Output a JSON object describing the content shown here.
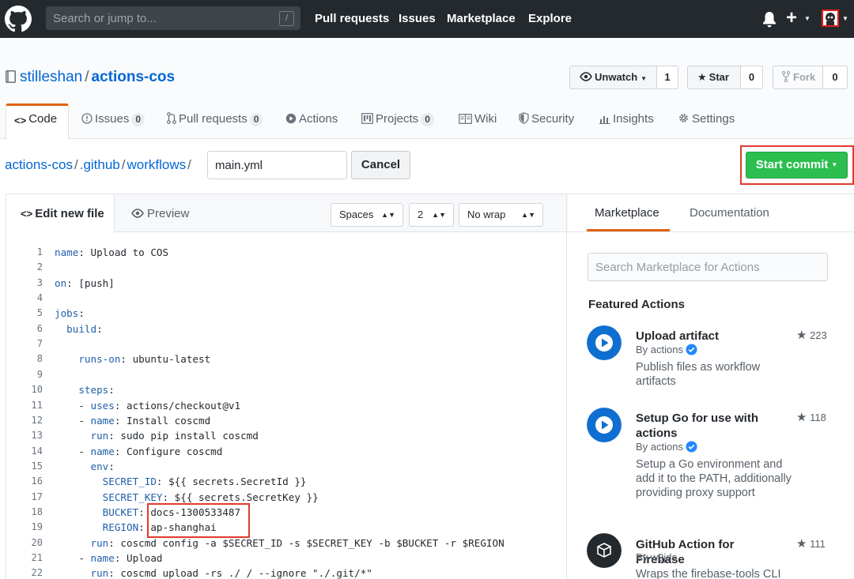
{
  "header": {
    "search_placeholder": "Search or jump to...",
    "search_key": "/",
    "nav": [
      "Pull requests",
      "Issues",
      "Marketplace",
      "Explore"
    ],
    "plus": "+"
  },
  "repo": {
    "owner": "stilleshan",
    "separator": "/",
    "name": "actions-cos",
    "watch_label": "Unwatch",
    "watch_count": "1",
    "star_label": "Star",
    "star_count": "0",
    "fork_label": "Fork",
    "fork_count": "0"
  },
  "tabs": [
    {
      "label": "Code"
    },
    {
      "label": "Issues",
      "count": "0"
    },
    {
      "label": "Pull requests",
      "count": "0"
    },
    {
      "label": "Actions"
    },
    {
      "label": "Projects",
      "count": "0"
    },
    {
      "label": "Wiki"
    },
    {
      "label": "Security"
    },
    {
      "label": "Insights"
    },
    {
      "label": "Settings"
    }
  ],
  "breadcrumb": [
    "actions-cos",
    ".github",
    "workflows"
  ],
  "breadcrumb_sep": "/",
  "file_name": "main.yml",
  "cancel_label": "Cancel",
  "commit_label": "Start commit",
  "editor": {
    "edit_tab": "Edit new file",
    "preview_tab": "Preview",
    "indent_mode": "Spaces",
    "indent_size": "2",
    "wrap_mode": "No wrap",
    "lines": [
      {
        "n": "1",
        "key": "name",
        "val": " Upload to COS",
        "indent": ""
      },
      {
        "n": "2",
        "key": "",
        "val": "",
        "indent": ""
      },
      {
        "n": "3",
        "key": "on",
        "val": " [push]",
        "indent": ""
      },
      {
        "n": "4",
        "key": "",
        "val": "",
        "indent": ""
      },
      {
        "n": "5",
        "key": "jobs",
        "val": "",
        "indent": ""
      },
      {
        "n": "6",
        "key": "build",
        "val": "",
        "indent": "  "
      },
      {
        "n": "7",
        "key": "",
        "val": "",
        "indent": ""
      },
      {
        "n": "8",
        "key": "runs-on",
        "val": " ubuntu-latest",
        "indent": "    "
      },
      {
        "n": "9",
        "key": "",
        "val": "",
        "indent": ""
      },
      {
        "n": "10",
        "key": "steps",
        "val": "",
        "indent": "    "
      },
      {
        "n": "11",
        "key": "uses",
        "val": " actions/checkout@v1",
        "indent": "    - "
      },
      {
        "n": "12",
        "key": "name",
        "val": " Install coscmd",
        "indent": "    - "
      },
      {
        "n": "13",
        "key": "run",
        "val": " sudo pip install coscmd",
        "indent": "      "
      },
      {
        "n": "14",
        "key": "name",
        "val": " Configure coscmd",
        "indent": "    - "
      },
      {
        "n": "15",
        "key": "env",
        "val": "",
        "indent": "      "
      },
      {
        "n": "16",
        "key": "SECRET_ID",
        "val": " ${{ secrets.SecretId }}",
        "indent": "        "
      },
      {
        "n": "17",
        "key": "SECRET_KEY",
        "val": " ${{ secrets.SecretKey }}",
        "indent": "        "
      },
      {
        "n": "18",
        "key": "BUCKET",
        "val": " docs-1300533487",
        "indent": "        "
      },
      {
        "n": "19",
        "key": "REGION",
        "val": " ap-shanghai",
        "indent": "        "
      },
      {
        "n": "20",
        "key": "run",
        "val": " coscmd config -a $SECRET_ID -s $SECRET_KEY -b $BUCKET -r $REGION",
        "indent": "      "
      },
      {
        "n": "21",
        "key": "name",
        "val": " Upload",
        "indent": "    - "
      },
      {
        "n": "22",
        "key": "run",
        "val": " coscmd upload -rs ./ / --ignore \"./.git/*\"",
        "indent": "      "
      }
    ]
  },
  "sidebar": {
    "tab_marketplace": "Marketplace",
    "tab_documentation": "Documentation",
    "search_placeholder": "Search Marketplace for Actions",
    "featured_title": "Featured Actions",
    "actions": [
      {
        "title": "Upload artifact",
        "by": "By actions",
        "desc": "Publish files as workflow artifacts",
        "stars": "223"
      },
      {
        "title": "Setup Go for use with actions",
        "by": "By actions",
        "desc": "Setup a Go environment and add it to the PATH, additionally providing proxy support",
        "stars": "118"
      },
      {
        "title": "GitHub Action for Firebase",
        "by": "By w9jds",
        "desc": "Wraps the firebase-tools CLI",
        "stars": "111"
      }
    ]
  },
  "colors": {
    "header_bg": "#24292e",
    "link": "#0366d6",
    "commit_green": "#2cbe4e",
    "highlight_red": "#e03a2e",
    "tab_accent": "#e36209",
    "action_blue": "#0f6fd1"
  }
}
